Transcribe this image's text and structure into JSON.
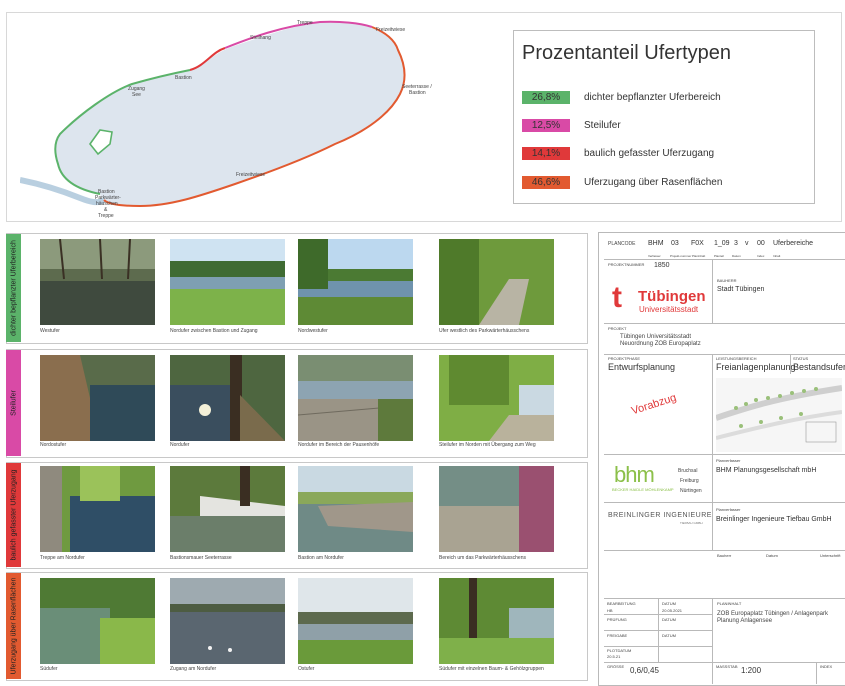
{
  "map": {
    "labels": [
      "Treppe",
      "Freizeitwiese",
      "Steilhang",
      "Bastion",
      "Zugang",
      "See",
      "Seeterrasse /",
      "Bastion",
      "Bastion",
      "Parkwärter-",
      "häuschen",
      "&",
      "Treppe",
      "Freizeitwiese"
    ]
  },
  "legend": {
    "title": "Prozentanteil Ufertypen",
    "items": [
      {
        "pct": "26,8%",
        "label": "dichter bepflanzter Uferbereich",
        "color": "#5bb36a"
      },
      {
        "pct": "12,5%",
        "label": "Steilufer",
        "color": "#d94aa6"
      },
      {
        "pct": "14,1%",
        "label": "baulich gefasster Uferzugang",
        "color": "#e0393a"
      },
      {
        "pct": "46,6%",
        "label": "Uferzugang über Rasenflächen",
        "color": "#e25a30"
      }
    ]
  },
  "rows": [
    {
      "label": "dichter bepflanzter Uferbereich",
      "color": "#5bb36a",
      "captions": [
        "Westufer",
        "Nordufer zwischen Bastion und Zugang",
        "Nordwestufer",
        "Ufer westlich des Parkwärterhäusschens"
      ]
    },
    {
      "label": "Steilufer",
      "color": "#d94aa6",
      "captions": [
        "Nordostufer",
        "Nordufer",
        "Nordufer im Bereich der Pausenhöfe",
        "Steilufer im Norden mit Übergang zum Weg"
      ]
    },
    {
      "label": "baulich gefasster Uferzugang",
      "color": "#e0393a",
      "captions": [
        "Treppe am Nordufer",
        "Bastionsmauer Seeterrasse",
        "Bastion am Nordufer",
        "Bereich um das Parkwärterhäusschens"
      ]
    },
    {
      "label": "Uferzugang über Rasenflächen",
      "color": "#e25a30",
      "captions": [
        "Südufer",
        "Zugang am Nordufer",
        "Ostufer",
        "Südufer mit einzelnen Baum- & Gehölzgruppen"
      ]
    }
  ],
  "titleblock": {
    "planCode": {
      "label": "PLANCODE",
      "cells": [
        "BHM",
        "03",
        "F0X",
        "1_09",
        "3",
        "v",
        "00",
        "Uferbereiche"
      ]
    },
    "planCodeSub": [
      "Verfasser",
      "Projekt-nummer",
      "Planinhalt",
      "Planteil",
      "Datum",
      "Index",
      "Inhalt"
    ],
    "projectNumberLabel": "PROJEKTNUMMER",
    "projectNumber": "1850",
    "bauherrLabel": "BAUHERR",
    "bauherr": "Stadt Tübingen",
    "logoLetter": "t",
    "logoName": "Tübingen",
    "logoSub": "Universitätsstadt",
    "projektLabel": "PROJEKT",
    "projekt1": "Tübingen Universitätsstadt",
    "projekt2": "Neuordnung ZOB Europaplatz",
    "phaseLabel": "PROJEKTPHASE",
    "phase": "Entwurfsplanung",
    "leistungLabel": "LEISTUNGSBEREICH",
    "leistung": "Freianlagenplanung",
    "statusLabel": "STATUS",
    "status": "Bestandsufer",
    "stamp": "Vorabzug",
    "planverfasserLabel": "Planverfasser",
    "bhmName": "BHM Planungsgesellschaft mbH",
    "bhmLogo": "bhm",
    "bhmLogoSub": "BECKER HAIDLE MÖHLENKAMP",
    "bhmCities": [
      "Bruchsal",
      "Freiburg",
      "Nürtingen"
    ],
    "breiLogo": "BREINLINGER INGENIEURE",
    "breiLogoSub": "TIEFBAU GMBH",
    "breiName": "Breinlinger Ingenieure Tiefbau GmbH",
    "freigabeCols": [
      "Bauherr",
      "Datum",
      "Unterschrift"
    ],
    "bearbeitungLabel": "BEARBEITUNG",
    "bearbeitung": "HB",
    "datumLabel": "DATUM",
    "datum": "20.05.2021",
    "pruefungLabel": "PRÜFUNG",
    "freigabeLabel": "FREIGABE",
    "datum2Label": "DATUM",
    "datum3Label": "DATUM",
    "plotLabel": "PLOTDATUM",
    "plotDate": "20.5.21",
    "planinhaltLabel": "PLANINHALT",
    "planinhalt1": "ZOB Europaplatz Tübingen / Anlagenpark",
    "planinhalt2": "Planung Anlagensee",
    "groesseLabel": "GRÖSSE",
    "groesse": "0,6/0,45",
    "massstabLabel": "MASSSTAB",
    "massstab": "1:200",
    "indexLabel": "INDEX"
  }
}
